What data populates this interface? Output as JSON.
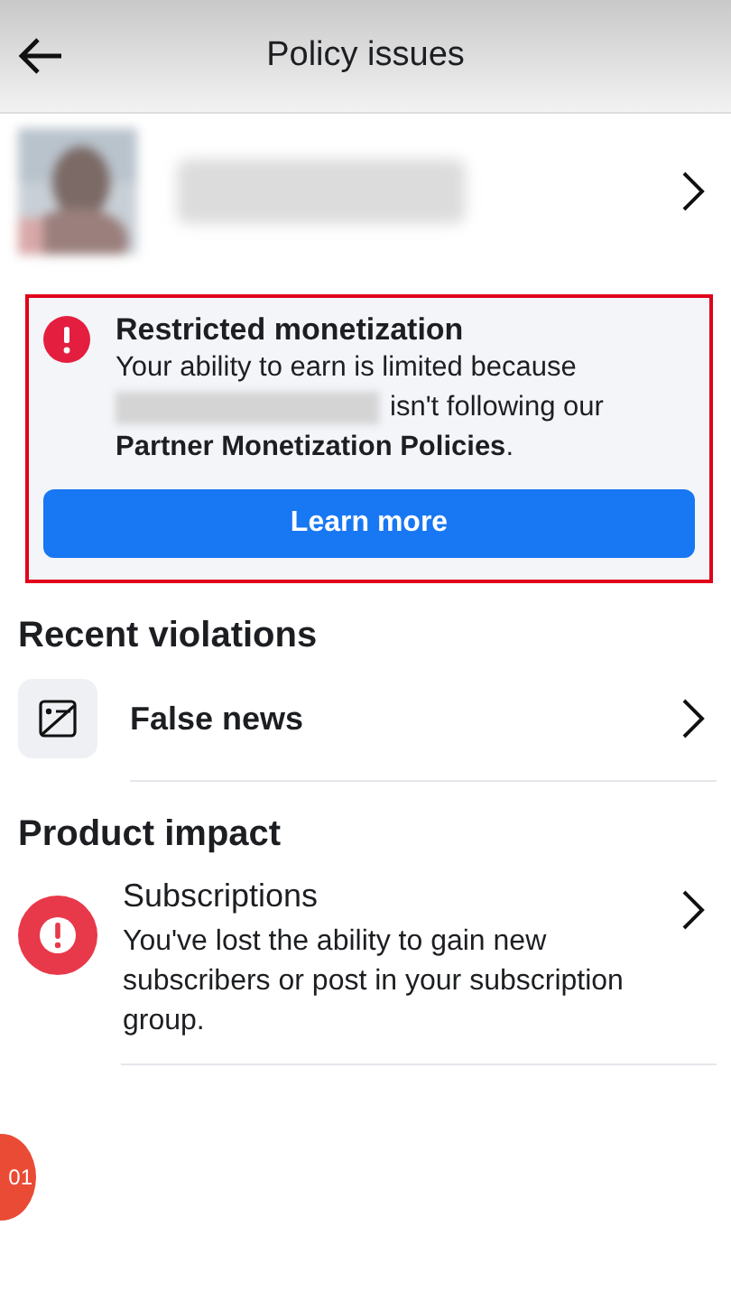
{
  "header": {
    "title": "Policy issues"
  },
  "alert": {
    "title": "Restricted monetization",
    "line_1": "Your ability to earn is limited because",
    "line_2": "isn't following our",
    "line_3": "**Partner Monetization Policies**.",
    "button": "Learn more"
  },
  "sections": [
    {
      "heading": "Recent violations",
      "items": [
        {
          "kind": "violation",
          "title": "False news"
        }
      ]
    },
    {
      "heading": "Product impact",
      "items": [
        {
          "kind": "impact",
          "title": "Subscriptions",
          "description": "You've lost the ability to gain new subscribers or post in your subscription group."
        }
      ]
    }
  ],
  "floating_badge": "01"
}
